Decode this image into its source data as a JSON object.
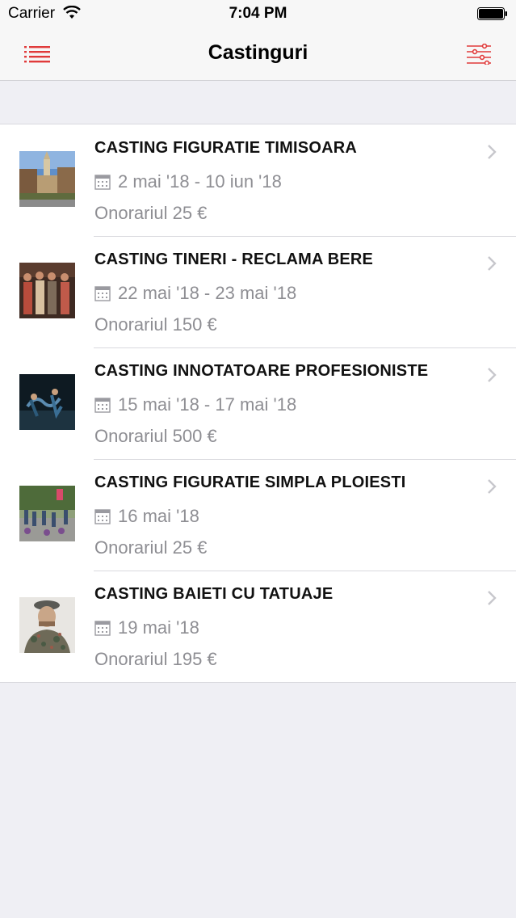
{
  "status_bar": {
    "carrier": "Carrier",
    "time": "7:04 PM"
  },
  "nav": {
    "title": "Castinguri",
    "left_icon": "list-menu-icon",
    "right_icon": "filter-sliders-icon",
    "accent_color": "#e03a3a"
  },
  "castings": [
    {
      "title": "CASTING FIGURATIE TIMISOARA",
      "dates": "2 mai '18 - 10 iun '18",
      "fee": "Onorariul 25 €"
    },
    {
      "title": "CASTING TINERI - RECLAMA BERE",
      "dates": "22 mai '18 - 23 mai '18",
      "fee": "Onorariul 150 €"
    },
    {
      "title": "CASTING INNOTATOARE PROFESIONISTE",
      "dates": "15 mai '18 - 17 mai '18",
      "fee": "Onorariul 500 €"
    },
    {
      "title": "CASTING FIGURATIE SIMPLA PLOIESTI",
      "dates": "16 mai '18",
      "fee": "Onorariul 25 €"
    },
    {
      "title": "CASTING BAIETI CU TATUAJE",
      "dates": "19 mai '18",
      "fee": "Onorariul 195 €"
    }
  ]
}
